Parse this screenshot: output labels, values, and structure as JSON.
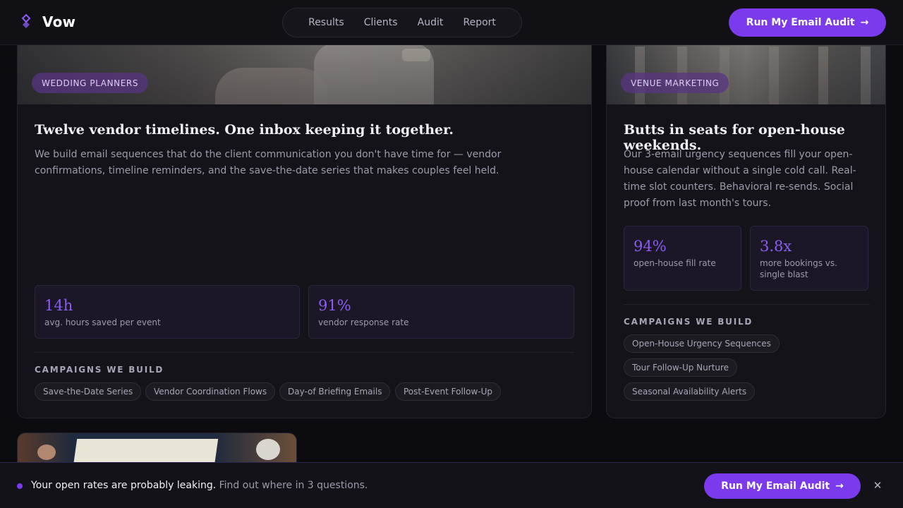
{
  "header": {
    "brand": "Vow",
    "nav": [
      "Results",
      "Clients",
      "Audit",
      "Report"
    ],
    "cta_label": "Run My Email Audit",
    "cta_icon": "arrow-right-icon"
  },
  "cards": [
    {
      "tag": "WEDDING PLANNERS",
      "title": "Twelve vendor timelines. One inbox keeping it together.",
      "description_lines": [
        "We build email sequences that do the client communication you don't have time for — vendor",
        "confirmations, timeline reminders, and the save-the-date series that makes couples feel held."
      ],
      "stats": [
        {
          "value": "14h",
          "label": "avg. hours saved per event"
        },
        {
          "value": "91%",
          "label": "vendor response rate"
        }
      ],
      "section_label": "CAMPAIGNS WE BUILD",
      "chips": [
        "Save-the-Date Series",
        "Vendor Coordination Flows",
        "Day-of Briefing Emails",
        "Post-Event Follow-Up"
      ]
    },
    {
      "tag": "VENUE MARKETING",
      "title": "Butts in seats for open-house weekends.",
      "description_lines": [
        "Our 3-email urgency sequences fill your open-",
        "house calendar without a single cold call. Real-",
        "time slot counters. Behavioral re-sends. Social",
        "proof from last month's tours."
      ],
      "stats": [
        {
          "value": "94%",
          "label_lines": [
            "open-house fill rate"
          ]
        },
        {
          "value": "3.8x",
          "label_lines": [
            "more bookings vs.",
            "single blast"
          ]
        }
      ],
      "section_label": "CAMPAIGNS WE BUILD",
      "chips": [
        "Open-House Urgency Sequences",
        "Tour Follow-Up Nurture",
        "Seasonal Availability Alerts"
      ]
    }
  ],
  "bottom_bar": {
    "strong_text": "Your open rates are probably leaking.",
    "muted_text": " Find out where in 3 questions.",
    "cta_label": "Run My Email Audit",
    "close_icon": "close-icon"
  },
  "colors": {
    "accent": "#7c3aed",
    "accent_light": "#8b5cf6",
    "background": "#0c0b0f",
    "card": "#141319"
  }
}
